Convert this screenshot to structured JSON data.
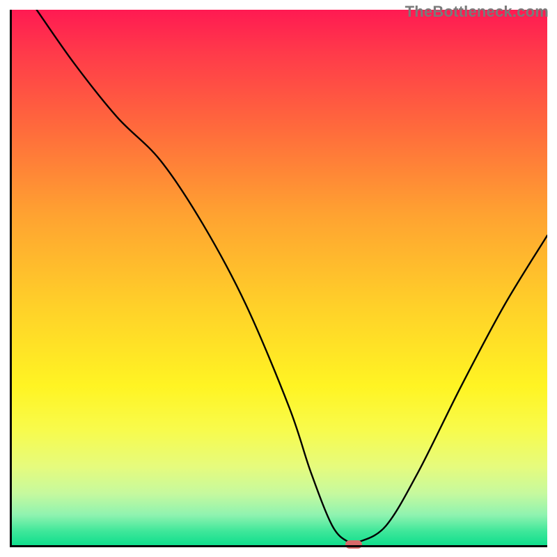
{
  "watermark": "TheBottleneck.com",
  "chart_data": {
    "type": "line",
    "title": "",
    "xlabel": "",
    "ylabel": "",
    "xlim": [
      0,
      100
    ],
    "ylim": [
      0,
      100
    ],
    "series": [
      {
        "name": "bottleneck-curve",
        "x": [
          5,
          12,
          20,
          28,
          36,
          44,
          52,
          56,
          60,
          63,
          65,
          70,
          76,
          84,
          92,
          100
        ],
        "y": [
          100,
          90,
          80,
          72,
          60,
          45,
          26,
          14,
          4,
          1,
          1,
          4,
          14,
          30,
          45,
          58
        ]
      }
    ],
    "marker": {
      "x": 64,
      "y": 0.5,
      "color": "#d96a6a"
    },
    "gradient_stops": [
      {
        "pct": 0,
        "color": "#ff1a52"
      },
      {
        "pct": 8,
        "color": "#ff3a4a"
      },
      {
        "pct": 22,
        "color": "#ff6a3c"
      },
      {
        "pct": 38,
        "color": "#ffa231"
      },
      {
        "pct": 55,
        "color": "#ffd029"
      },
      {
        "pct": 70,
        "color": "#fff423"
      },
      {
        "pct": 78,
        "color": "#f8fb4b"
      },
      {
        "pct": 85,
        "color": "#e6fb7d"
      },
      {
        "pct": 90,
        "color": "#c6f99e"
      },
      {
        "pct": 94,
        "color": "#8ff3b0"
      },
      {
        "pct": 97,
        "color": "#3fe79a"
      },
      {
        "pct": 100,
        "color": "#09dd8b"
      }
    ]
  }
}
